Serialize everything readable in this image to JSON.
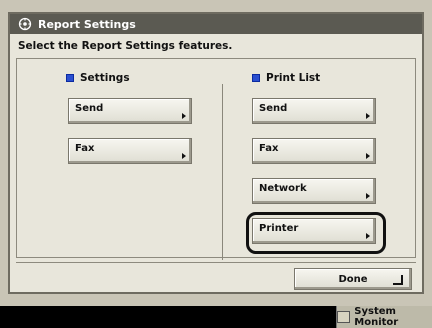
{
  "window": {
    "title": "Report Settings",
    "instruction": "Select the Report Settings features."
  },
  "settings": {
    "label": "Settings",
    "buttons": [
      "Send",
      "Fax"
    ]
  },
  "print_list": {
    "label": "Print List",
    "buttons": [
      "Send",
      "Fax",
      "Network",
      "Printer"
    ]
  },
  "footer": {
    "done_label": "Done"
  },
  "status_bar": {
    "system_monitor_label": "System Monitor"
  }
}
